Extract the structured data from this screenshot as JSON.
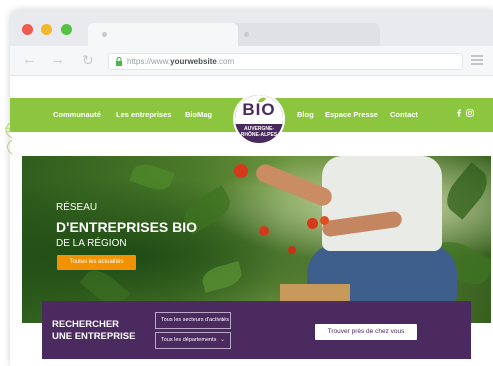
{
  "browser": {
    "url_prefix": "https://www.",
    "url_domain": "yourwebsite",
    "url_suffix": ".com"
  },
  "site": {
    "nav_left": [
      "Communauté",
      "Les entreprises",
      "BioMag"
    ],
    "nav_right": [
      "Blog",
      "Espace Presse",
      "Contact"
    ],
    "logo": {
      "word": "BIO",
      "line1": "AUVERGNE-",
      "line2": "RHÔNE-ALPES"
    },
    "social_icons": [
      "facebook-icon",
      "instagram-icon"
    ]
  },
  "hero": {
    "line1": "RÉSEAU",
    "line2": "D'ENTREPRISES BIO",
    "line3": "DE LA RÉGION",
    "news_button": "Toutes les actualités"
  },
  "search": {
    "title_line1": "RECHERCHER",
    "title_line2": "UNE ENTREPRISE",
    "sector_select": "Tous les secteurs d'activités",
    "department_select": "Tous les départements",
    "near_me_button": "Trouver près de chez vous"
  },
  "colors": {
    "nav_green": "#8cc63f",
    "brand_purple": "#4b2a60",
    "accent_orange": "#f39200"
  }
}
